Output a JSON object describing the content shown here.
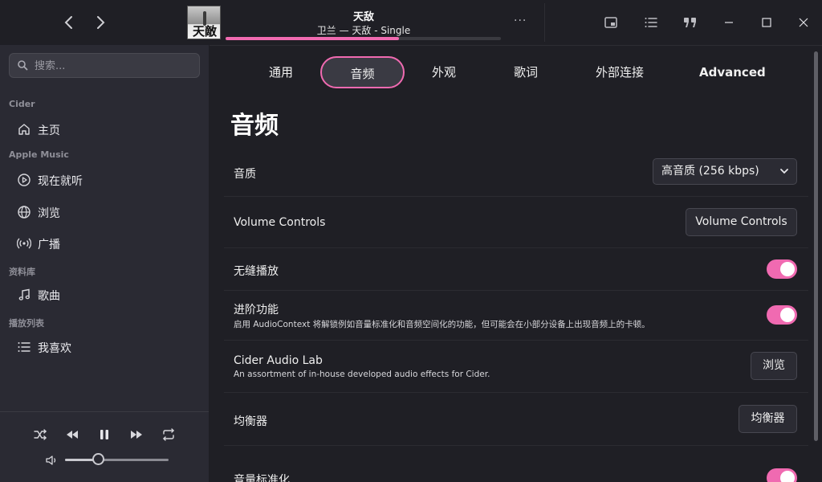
{
  "topbar": {
    "back_label": "‹",
    "forward_label": "›",
    "album_art_text": "天敵",
    "track_title": "天敌",
    "track_subtitle": "卫兰 — 天敌 - Single",
    "progress_percent": 63,
    "more_label": "···"
  },
  "sidebar": {
    "search_placeholder": "搜索...",
    "sections": {
      "cider": "Cider",
      "apple_music": "Apple Music",
      "library": "资料库",
      "playlists": "播放列表"
    },
    "items": {
      "home": "主页",
      "listen_now": "现在就听",
      "browse": "浏览",
      "radio": "广播",
      "songs": "歌曲",
      "favorites": "我喜欢"
    },
    "volume_percent": 32
  },
  "tabs": [
    "通用",
    "音频",
    "外观",
    "歌词",
    "外部连接",
    "Advanced"
  ],
  "active_tab": "音频",
  "page_heading": "音频",
  "settings": {
    "quality": {
      "title": "音质",
      "value": "高音质 (256 kbps)"
    },
    "volume_controls": {
      "title": "Volume Controls",
      "button": "Volume Controls"
    },
    "seamless": {
      "title": "无缝播放",
      "on": true
    },
    "advanced": {
      "title": "进阶功能",
      "desc": "启用 AudioContext 将解锁例如音量标准化和音频空间化的功能，但可能会在小部分设备上出现音频上的卡顿。",
      "on": true
    },
    "audio_lab": {
      "title": "Cider Audio Lab",
      "desc": "An assortment of in-house developed audio effects for Cider.",
      "button": "浏览"
    },
    "equalizer": {
      "title": "均衡器",
      "button": "均衡器"
    },
    "normalization": {
      "title": "音量标准化",
      "on": true
    }
  },
  "colors": {
    "accent": "#f06ab1",
    "sidebar_bg": "#2a2a33",
    "main_bg": "#1f1f25"
  }
}
